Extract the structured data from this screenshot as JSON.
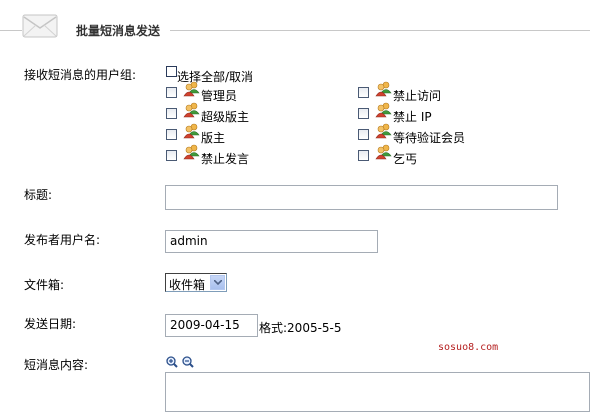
{
  "header": {
    "title": "批量短消息发送",
    "icon": "envelope-icon"
  },
  "recipients": {
    "label": "接收短消息的用户组:",
    "select_all_label": "选择全部/取消",
    "groups": [
      {
        "label": "管理员",
        "checked": false,
        "icon": "user-group-icon"
      },
      {
        "label": "禁止访问",
        "checked": false,
        "icon": "user-group-icon"
      },
      {
        "label": "超级版主",
        "checked": false,
        "icon": "user-group-icon"
      },
      {
        "label": "禁止 IP",
        "checked": false,
        "icon": "user-group-icon"
      },
      {
        "label": "版主",
        "checked": false,
        "icon": "user-group-icon"
      },
      {
        "label": "等待验证会员",
        "checked": false,
        "icon": "user-group-icon"
      },
      {
        "label": "禁止发言",
        "checked": false,
        "icon": "user-group-icon"
      },
      {
        "label": "乞丐",
        "checked": false,
        "icon": "user-group-icon"
      }
    ]
  },
  "title_field": {
    "label": "标题:",
    "value": ""
  },
  "sender_field": {
    "label": "发布者用户名:",
    "value": "admin"
  },
  "folder_field": {
    "label": "文件箱:",
    "selected": "收件箱"
  },
  "date_field": {
    "label": "发送日期:",
    "value": "2009-04-15",
    "format_hint": "格式:2005-5-5"
  },
  "content_field": {
    "label": "短消息内容:",
    "zoom_in_icon": "zoom-in-icon",
    "zoom_out_icon": "zoom-out-icon"
  },
  "watermark": "sosuo8.com"
}
